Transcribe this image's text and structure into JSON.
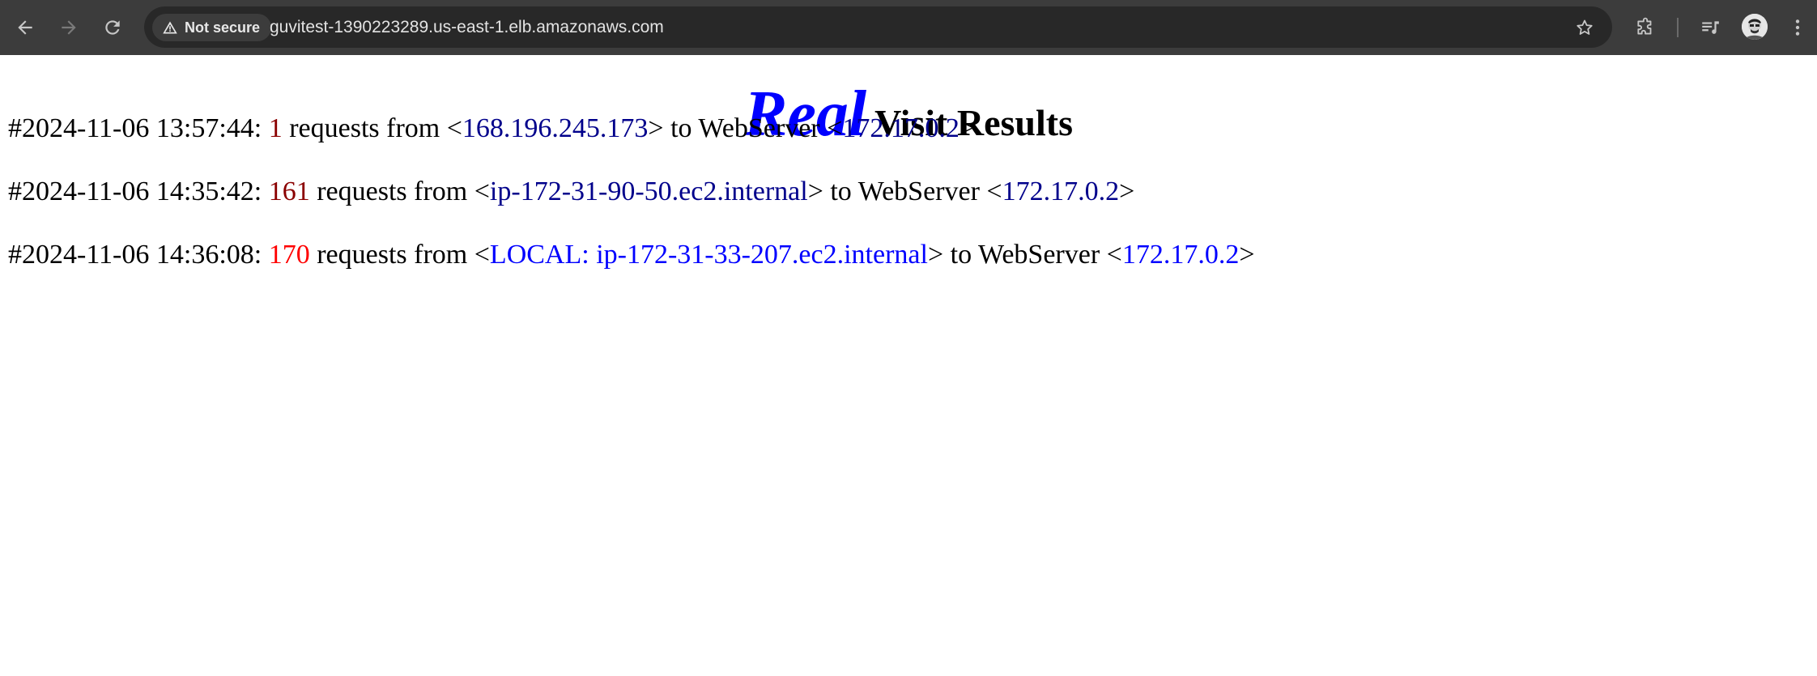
{
  "browser": {
    "security_label": "Not secure",
    "url": "guvitest-1390223289.us-east-1.elb.amazonaws.com"
  },
  "page": {
    "heading_emphasis": "Real",
    "heading_rest": "Visit Results",
    "log_entries": [
      {
        "prefix": "#2024-11-06 13:57:44: ",
        "count": "1",
        "count_color": "#8b0000",
        "mid1": " requests from <",
        "source": "168.196.245.173",
        "source_color": "#00008b",
        "mid2": "> to WebServer <",
        "server": "172.17.0.2",
        "server_color": "#00008b",
        "suffix": ">"
      },
      {
        "prefix": "#2024-11-06 14:35:42: ",
        "count": "161",
        "count_color": "#8b0000",
        "mid1": " requests from <",
        "source": "ip-172-31-90-50.ec2.internal",
        "source_color": "#00008b",
        "mid2": "> to WebServer <",
        "server": "172.17.0.2",
        "server_color": "#00008b",
        "suffix": ">"
      },
      {
        "prefix": "#2024-11-06 14:36:08: ",
        "count": "170",
        "count_color": "#ff0000",
        "mid1": " requests from <",
        "source": "LOCAL: ip-172-31-33-207.ec2.internal",
        "source_color": "#0000ff",
        "mid2": "> to WebServer <",
        "server": "172.17.0.2",
        "server_color": "#0000ff",
        "suffix": ">"
      }
    ]
  },
  "colors": {
    "toolbar_bg": "#3c3c3c",
    "omnibox_bg": "#282828",
    "heading_emphasis": "#0000ff"
  },
  "icons": {
    "back": "arrow-left-icon",
    "forward": "arrow-right-icon",
    "reload": "reload-icon",
    "warning": "warning-triangle-icon",
    "star": "star-icon",
    "extensions": "puzzle-icon",
    "media": "media-control-icon",
    "menu": "kebab-menu-icon"
  }
}
